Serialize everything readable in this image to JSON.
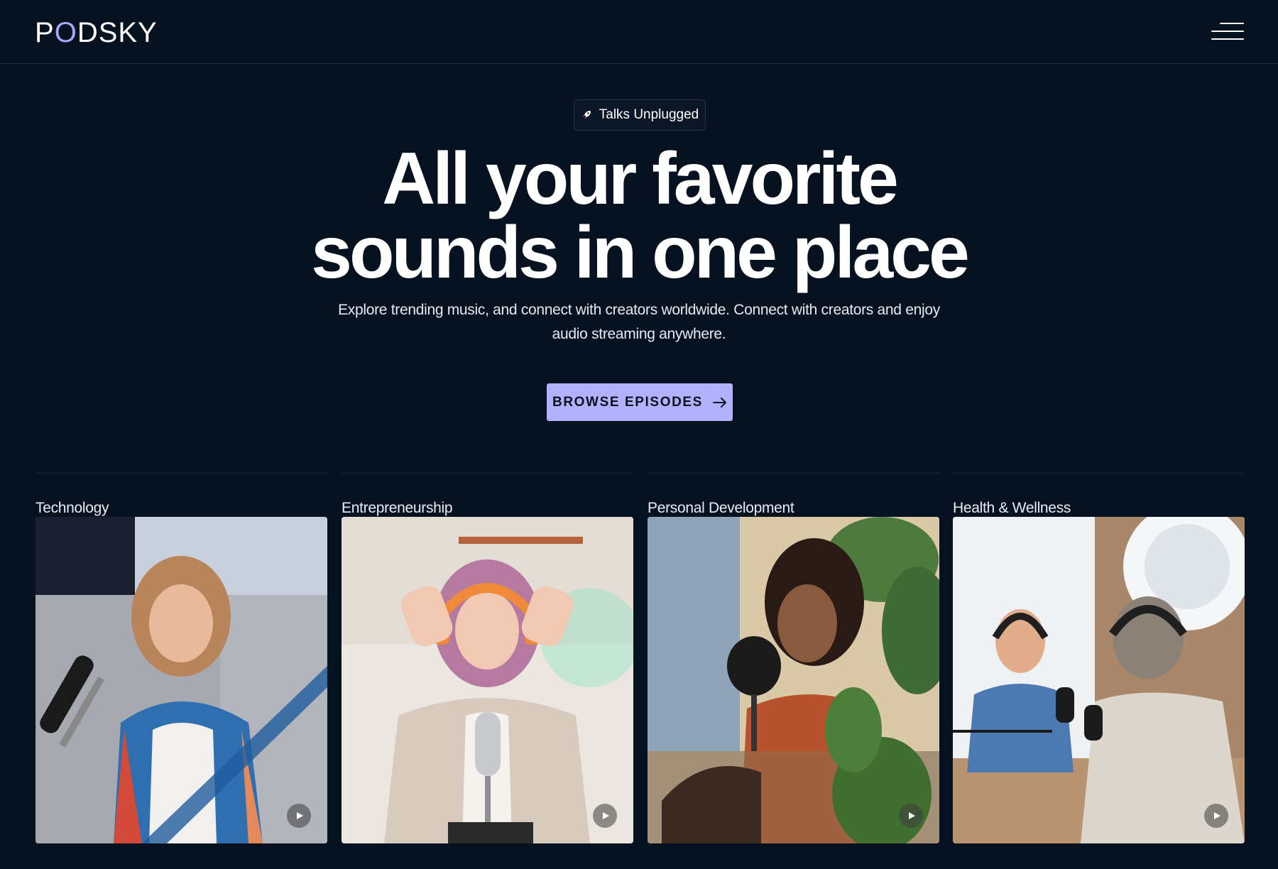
{
  "header": {
    "logo_part1": "P",
    "logo_part2": "O",
    "logo_part3": "DSKY",
    "accent_color": "#a9a6f6",
    "menu_icon": "hamburger-menu-icon"
  },
  "hero": {
    "badge_icon": "rocket-icon",
    "badge_text": "Talks Unplugged",
    "title_line1": "All your favorite",
    "title_line2": "sounds in one place",
    "subtitle": "Explore trending music, and connect with creators worldwide. Connect with creators and enjoy audio streaming anywhere.",
    "cta_label": "BROWSE EPISODES",
    "cta_icon": "arrow-right-icon",
    "cta_color": "#b3b1fb"
  },
  "categories": [
    {
      "label": "Technology",
      "image": "woman-with-microphone-on-couch",
      "play_icon": "play-icon"
    },
    {
      "label": "Entrepreneurship",
      "image": "woman-with-orange-headphones",
      "play_icon": "play-icon"
    },
    {
      "label": "Personal Development",
      "image": "woman-speaking-into-microphone",
      "play_icon": "play-icon"
    },
    {
      "label": "Health & Wellness",
      "image": "two-men-podcast-interview",
      "play_icon": "play-icon"
    }
  ],
  "theme": {
    "background": "#071221"
  }
}
